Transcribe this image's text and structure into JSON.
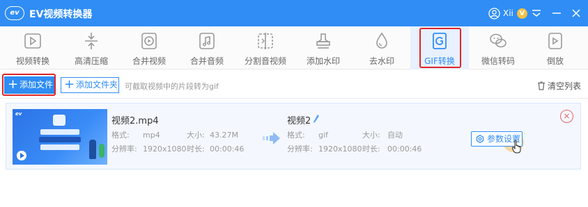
{
  "app": {
    "logo_text": "ev",
    "title": "EV视频转换器",
    "user_name": "Xii",
    "vip_badge": "V"
  },
  "toolbar": {
    "items": [
      {
        "label": "视频转换",
        "icon": "video-convert-icon"
      },
      {
        "label": "高清压缩",
        "icon": "compress-icon"
      },
      {
        "label": "合并视频",
        "icon": "merge-video-icon"
      },
      {
        "label": "合并音频",
        "icon": "merge-audio-icon"
      },
      {
        "label": "分割音视频",
        "icon": "split-icon"
      },
      {
        "label": "添加水印",
        "icon": "stamp-icon"
      },
      {
        "label": "去水印",
        "icon": "droplet-icon"
      },
      {
        "label": "GIF转换",
        "icon": "gif-icon",
        "active": true
      },
      {
        "label": "微信转码",
        "icon": "wechat-icon"
      },
      {
        "label": "倒放",
        "icon": "reverse-icon"
      }
    ]
  },
  "actions": {
    "add_file": "添加文件",
    "add_folder": "添加文件夹",
    "hint": "可截取视频中的片段转为gif",
    "clear_list": "清空列表"
  },
  "file": {
    "thumb_logo": "ev",
    "source": {
      "name": "视频2.mp4",
      "format_label": "格式:",
      "format": "mp4",
      "size_label": "大小:",
      "size": "43.27M",
      "resolution_label": "分辨率:",
      "resolution": "1920x1080",
      "duration_label": "时长:",
      "duration": "00:00:46"
    },
    "output": {
      "name": "视频2",
      "format_label": "格式:",
      "format": "gif",
      "size_label": "大小:",
      "size": "自动",
      "resolution_label": "分辨率:",
      "resolution": "1920x1080",
      "duration_label": "时长:",
      "duration": "00:00:46"
    },
    "param_button": "参数设置",
    "remove": "×"
  },
  "colors": {
    "primary": "#2f8df5",
    "highlight": "#e0262a",
    "remove": "#e8646b"
  }
}
